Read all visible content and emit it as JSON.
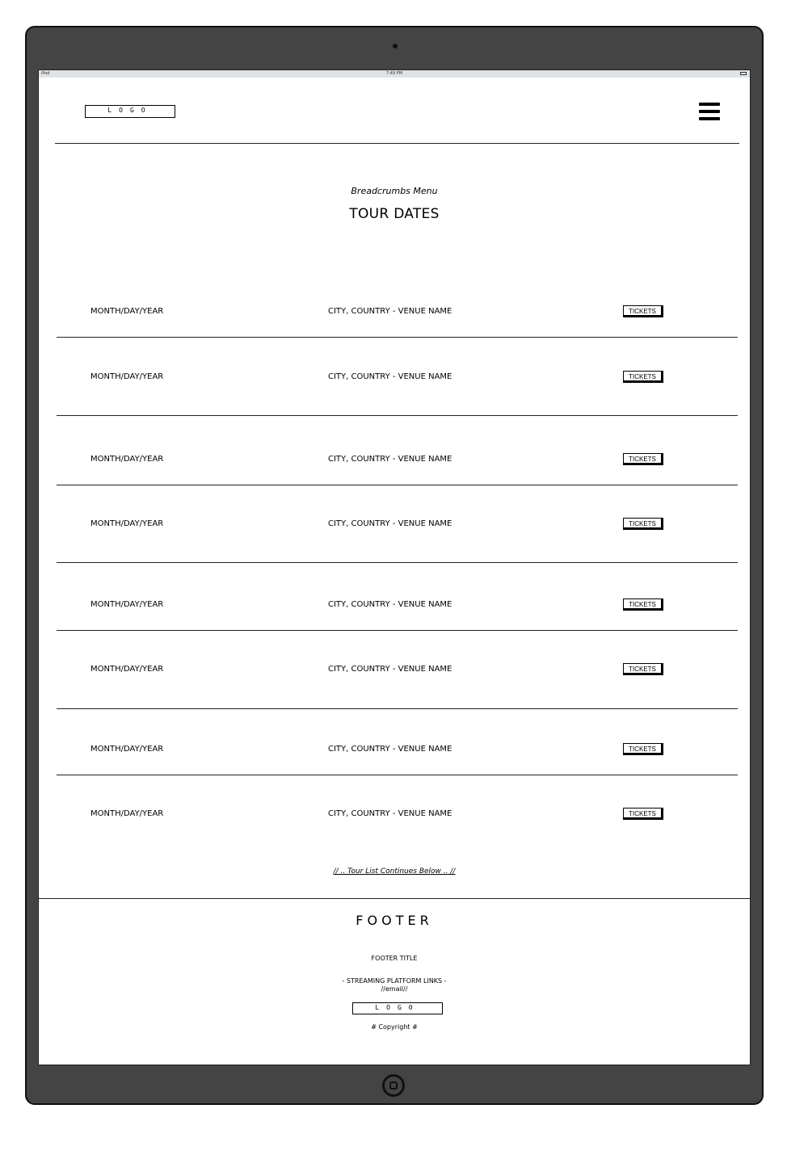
{
  "statusbar": {
    "device": "iPad",
    "time": "7:49 PM"
  },
  "header": {
    "logo": "LOGO"
  },
  "breadcrumbs": "Breadcrumbs Menu",
  "page_title": "TOUR DATES",
  "tour_rows": [
    {
      "date": "MONTH/DAY/YEAR",
      "venue": "CITY, COUNTRY - VENUE NAME",
      "button": "TICKETS"
    },
    {
      "date": "MONTH/DAY/YEAR",
      "venue": "CITY, COUNTRY - VENUE NAME",
      "button": "TICKETS"
    },
    {
      "date": "MONTH/DAY/YEAR",
      "venue": "CITY, COUNTRY - VENUE NAME",
      "button": "TICKETS"
    },
    {
      "date": "MONTH/DAY/YEAR",
      "venue": "CITY, COUNTRY - VENUE NAME",
      "button": "TICKETS"
    },
    {
      "date": "MONTH/DAY/YEAR",
      "venue": "CITY, COUNTRY - VENUE NAME",
      "button": "TICKETS"
    },
    {
      "date": "MONTH/DAY/YEAR",
      "venue": "CITY, COUNTRY - VENUE NAME",
      "button": "TICKETS"
    },
    {
      "date": "MONTH/DAY/YEAR",
      "venue": "CITY, COUNTRY - VENUE NAME",
      "button": "TICKETS"
    },
    {
      "date": "MONTH/DAY/YEAR",
      "venue": "CITY, COUNTRY - VENUE NAME",
      "button": "TICKETS"
    }
  ],
  "continues": "// .. Tour List Continues Below .. //",
  "footer": {
    "heading": "FOOTER",
    "title": "FOOTER TITLE",
    "streaming": "-  STREAMING PLATFORM LINKS -",
    "email": "//email//",
    "logo": "LOGO",
    "copyright": "# Copyright #"
  }
}
